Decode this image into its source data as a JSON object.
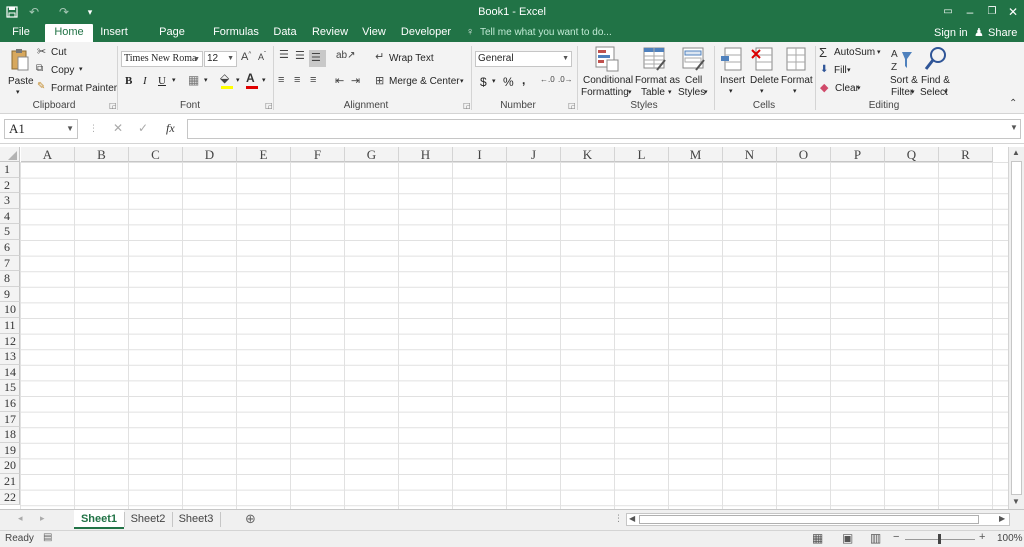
{
  "window": {
    "title": "Book1 - Excel",
    "sign_in": "Sign in",
    "share": "Share"
  },
  "tabs": [
    "File",
    "Home",
    "Insert",
    "Page Layout",
    "Formulas",
    "Data",
    "Review",
    "View",
    "Developer"
  ],
  "tell_me": "Tell me what you want to do...",
  "clipboard": {
    "paste": "Paste",
    "cut": "Cut",
    "copy": "Copy",
    "format_painter": "Format Painter",
    "label": "Clipboard"
  },
  "font": {
    "name": "Times New Roma",
    "size": "12",
    "label": "Font",
    "bold": "B",
    "italic": "I",
    "underline": "U"
  },
  "alignment": {
    "wrap_text": "Wrap Text",
    "merge_center": "Merge & Center",
    "label": "Alignment"
  },
  "number": {
    "format": "General",
    "currency": "$",
    "percent": "%",
    "comma": ",",
    "label": "Number"
  },
  "styles": {
    "conditional": [
      "Conditional",
      "Formatting"
    ],
    "format_table": [
      "Format as",
      "Table"
    ],
    "cell_styles": [
      "Cell",
      "Styles"
    ],
    "label": "Styles"
  },
  "cells": {
    "insert": "Insert",
    "delete": "Delete",
    "format": "Format",
    "label": "Cells"
  },
  "editing": {
    "autosum": "AutoSum",
    "fill": "Fill",
    "clear": "Clear",
    "sort": [
      "Sort &",
      "Filter"
    ],
    "find": [
      "Find &",
      "Select"
    ],
    "label": "Editing"
  },
  "formula_bar": {
    "name_box": "A1",
    "fx": "fx",
    "value": ""
  },
  "columns": [
    "A",
    "B",
    "C",
    "D",
    "E",
    "F",
    "G",
    "H",
    "I",
    "J",
    "K",
    "L",
    "M",
    "N",
    "O",
    "P",
    "Q",
    "R"
  ],
  "rows": [
    "1",
    "2",
    "3",
    "4",
    "5",
    "6",
    "7",
    "8",
    "9",
    "10",
    "11",
    "12",
    "13",
    "14",
    "15",
    "16",
    "17",
    "18",
    "19",
    "20",
    "21",
    "22"
  ],
  "sheets": [
    "Sheet1",
    "Sheet2",
    "Sheet3"
  ],
  "active_sheet": "Sheet1",
  "status": {
    "ready": "Ready",
    "zoom": "100%"
  },
  "colors": {
    "accent": "#217346",
    "ribbon_bg": "#f3f3f3",
    "grid_line": "#e1e1e1"
  }
}
